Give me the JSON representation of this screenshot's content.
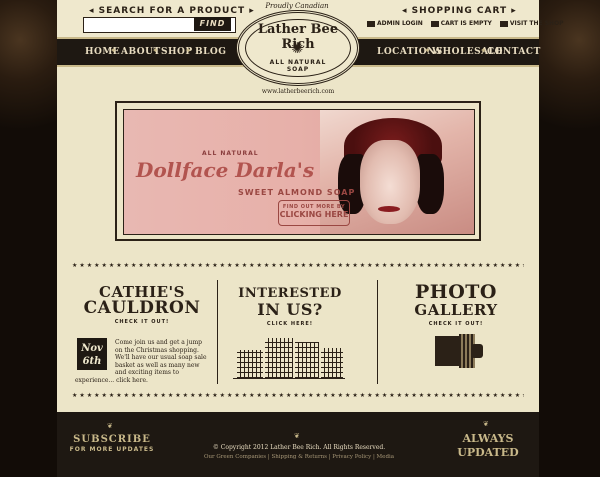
{
  "header": {
    "search_title": "◂ SEARCH FOR A PRODUCT ▸",
    "search_placeholder": "",
    "search_button": "FIND",
    "cart_title": "◂ SHOPPING CART ▸",
    "cart_links": [
      "ADMIN LOGIN",
      "CART IS EMPTY",
      "VISIT THE SHOP"
    ]
  },
  "logo": {
    "tagline": "Proudly Canadian",
    "name": "Lather Bee Rich",
    "sub": "ALL NATURAL SOAP",
    "url": "www.latherbeerich.com"
  },
  "nav": {
    "left": [
      "HOME",
      "ABOUT",
      "SHOP",
      "BLOG"
    ],
    "right": [
      "LOCATIONS",
      "WHOLESALE",
      "CONTACT"
    ]
  },
  "banner": {
    "all_natural": "ALL NATURAL",
    "title": "Dollface Darla's",
    "subtitle": "SWEET ALMOND SOAP",
    "cta_line1": "FIND OUT MORE BY",
    "cta_line2": "CLICKING HERE"
  },
  "sections": {
    "cauldron": {
      "title1": "CATHIE'S",
      "title2": "CAULDRON",
      "cta": "CHECK IT OUT!"
    },
    "news": {
      "month": "Nov",
      "day": "6th",
      "text": "Come join us and get a jump on the Christmas shopping. We'll have our usual soap sale basket as well as many new and exciting items to",
      "text_cont": "experience... click here."
    },
    "interested": {
      "title1": "INTERESTED",
      "title2": "IN US?",
      "cta": "CLICK HERE!"
    },
    "gallery": {
      "title1": "PHOTO",
      "title2": "GALLERY",
      "cta": "CHECK IT OUT!"
    }
  },
  "footer": {
    "subscribe1": "SUBSCRIBE",
    "subscribe2": "FOR MORE UPDATES",
    "always1": "ALWAYS",
    "always2": "UPDATED",
    "copyright": "© Copyright 2012 Lather Bee Rich. All Rights Reserved.",
    "links": "Our Green Companies | Shipping & Returns | Privacy Policy | Media"
  },
  "colors": {
    "dark": "#1e1812",
    "cream": "#ece5c8",
    "pink": "#e8b8b2",
    "gold": "#c9b98a"
  }
}
